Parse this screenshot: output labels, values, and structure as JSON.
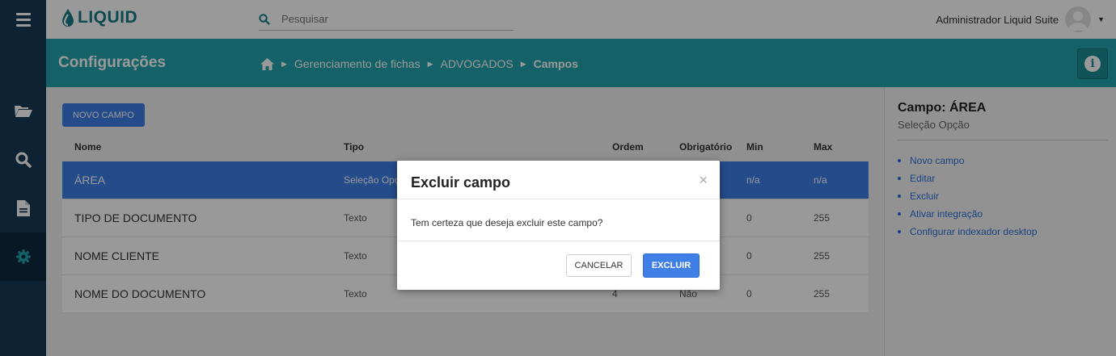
{
  "app": {
    "logo_text": "LIQUID",
    "search_placeholder": "Pesquisar",
    "user_name": "Administrador Liquid Suite"
  },
  "header": {
    "title": "Configurações",
    "breadcrumb": [
      "Gerenciamento de fichas",
      "ADVOGADOS",
      "Campos"
    ]
  },
  "main": {
    "new_button": "NOVO CAMPO",
    "columns": {
      "nome": "Nome",
      "tipo": "Tipo",
      "ordem": "Ordem",
      "obrigatorio": "Obrigatório",
      "min": "Min",
      "max": "Max"
    },
    "rows": [
      {
        "nome": "ÁREA",
        "tipo": "Seleção Opção",
        "ordem": "",
        "obrigatorio": "",
        "min": "n/a",
        "max": "n/a",
        "selected": true
      },
      {
        "nome": "TIPO DE DOCUMENTO",
        "tipo": "Texto",
        "ordem": "",
        "obrigatorio": "",
        "min": "0",
        "max": "255"
      },
      {
        "nome": "NOME CLIENTE",
        "tipo": "Texto",
        "ordem": "",
        "obrigatorio": "",
        "min": "0",
        "max": "255"
      },
      {
        "nome": "NOME DO DOCUMENTO",
        "tipo": "Texto",
        "ordem": "4",
        "obrigatorio": "Não",
        "min": "0",
        "max": "255"
      }
    ]
  },
  "right_panel": {
    "title": "Campo: ÁREA",
    "subtitle": "Seleção Opção",
    "actions": [
      "Novo campo",
      "Editar",
      "Excluir",
      "Ativar integração",
      "Configurar indexador desktop"
    ]
  },
  "modal": {
    "title": "Excluir campo",
    "close": "×",
    "body": "Tem certeza que deseja excluir este campo?",
    "cancel": "CANCELAR",
    "confirm": "EXCLUIR"
  },
  "colors": {
    "sidebar": "#173a56",
    "teal": "#22a3ac",
    "accent": "#3f7fe6"
  }
}
